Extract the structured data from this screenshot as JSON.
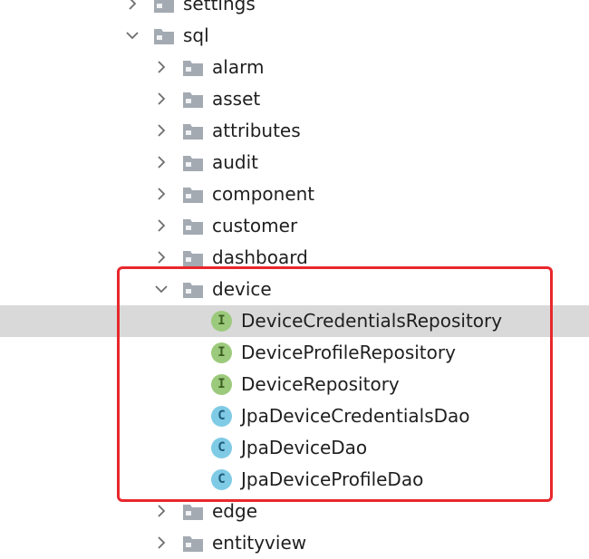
{
  "tree": {
    "nodes": [
      {
        "label": "settings",
        "kind": "folder",
        "expanded": false
      },
      {
        "label": "sql",
        "kind": "folder",
        "expanded": true
      },
      {
        "label": "alarm",
        "kind": "folder",
        "expanded": false
      },
      {
        "label": "asset",
        "kind": "folder",
        "expanded": false
      },
      {
        "label": "attributes",
        "kind": "folder",
        "expanded": false
      },
      {
        "label": "audit",
        "kind": "folder",
        "expanded": false
      },
      {
        "label": "component",
        "kind": "folder",
        "expanded": false
      },
      {
        "label": "customer",
        "kind": "folder",
        "expanded": false
      },
      {
        "label": "dashboard",
        "kind": "folder",
        "expanded": false
      },
      {
        "label": "device",
        "kind": "folder",
        "expanded": true
      },
      {
        "label": "DeviceCredentialsRepository",
        "kind": "interface",
        "badge": "I",
        "selected": true
      },
      {
        "label": "DeviceProfileRepository",
        "kind": "interface",
        "badge": "I"
      },
      {
        "label": "DeviceRepository",
        "kind": "interface",
        "badge": "I"
      },
      {
        "label": "JpaDeviceCredentialsDao",
        "kind": "class",
        "badge": "C"
      },
      {
        "label": "JpaDeviceDao",
        "kind": "class",
        "badge": "C"
      },
      {
        "label": "JpaDeviceProfileDao",
        "kind": "class",
        "badge": "C"
      },
      {
        "label": "edge",
        "kind": "folder",
        "expanded": false
      },
      {
        "label": "entityview",
        "kind": "folder",
        "expanded": false
      }
    ]
  },
  "colors": {
    "selection": "#d9d9d9",
    "highlight_border": "#e8272c",
    "interface_badge": "#9cca7c",
    "class_badge": "#7fcbe6",
    "folder": "#a3aab2"
  },
  "icons": {
    "collapsed": "chevron-right-icon",
    "expanded": "chevron-down-icon",
    "folder": "folder-icon",
    "interface": "interface-icon",
    "class": "class-icon"
  }
}
